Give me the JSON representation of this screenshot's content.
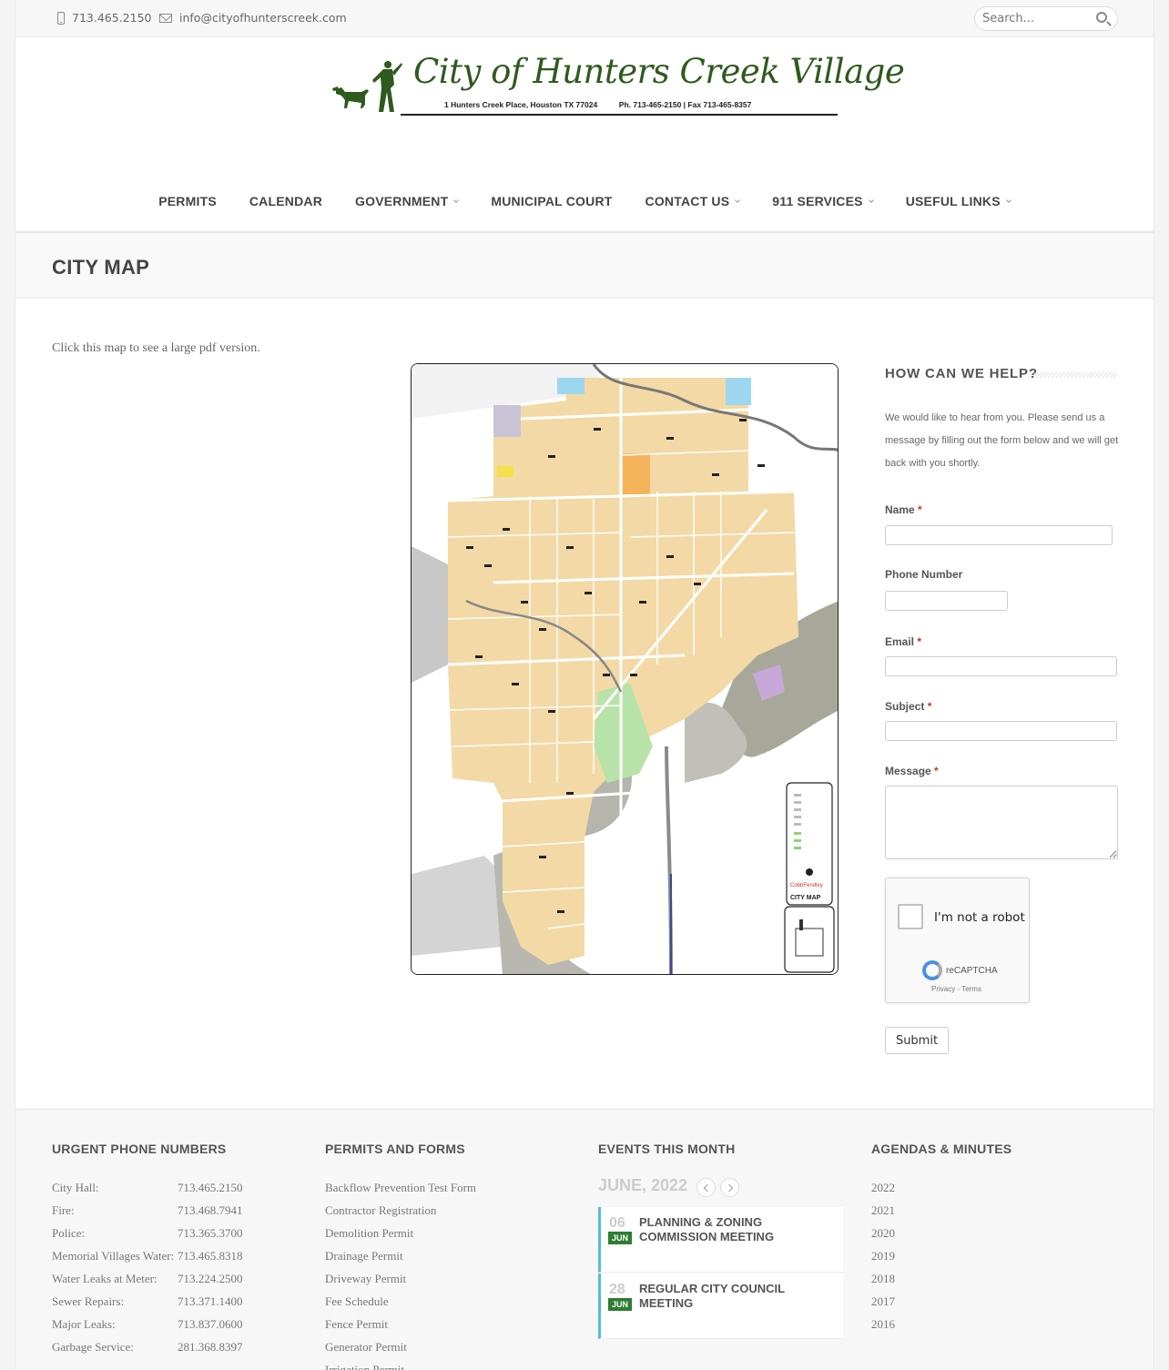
{
  "topbar": {
    "phone": "713.465.2150",
    "email": "info@cityofhunterscreek.com",
    "search_placeholder": "Search..."
  },
  "logo": {
    "title": "City of Hunters Creek Village",
    "subtitle": "1 Hunters Creek Place, Houston TX 77024          Ph. 713-465-2150 | Fax 713-465-8357"
  },
  "nav": [
    {
      "label": "PERMITS",
      "dropdown": false
    },
    {
      "label": "CALENDAR",
      "dropdown": false
    },
    {
      "label": "GOVERNMENT",
      "dropdown": true
    },
    {
      "label": "MUNICIPAL COURT",
      "dropdown": false
    },
    {
      "label": "CONTACT US",
      "dropdown": true
    },
    {
      "label": "911 SERVICES",
      "dropdown": true
    },
    {
      "label": "USEFUL LINKS",
      "dropdown": true
    }
  ],
  "page": {
    "title": "CITY MAP",
    "intro": "Click this map to see a large pdf version."
  },
  "map": {
    "legend_title": "CITY MAP",
    "legend_brand": "CobbFendley"
  },
  "sidebar": {
    "title": "HOW CAN WE HELP?",
    "text": "We would like to hear from you. Please send us a message by filling out the form below and we will get back with you shortly.",
    "fields": {
      "name": "Name",
      "phone": "Phone Number",
      "email": "Email",
      "subject": "Subject",
      "message": "Message"
    },
    "required_mark": "*",
    "captcha": {
      "label": "I'm not a robot",
      "brand": "reCAPTCHA",
      "links": "Privacy - Terms"
    },
    "submit": "Submit"
  },
  "footer": {
    "phones_title": "URGENT PHONE NUMBERS",
    "phones": [
      {
        "label": "City Hall:",
        "value": "713.465.2150"
      },
      {
        "label": "Fire:",
        "value": "713.468.7941"
      },
      {
        "label": "Police:",
        "value": "713.365.3700"
      },
      {
        "label": "Memorial Villages Water:",
        "value": "713.465.8318"
      },
      {
        "label": "Water Leaks at Meter:",
        "value": "713.224.2500"
      },
      {
        "label": "Sewer Repairs:",
        "value": "713.371.1400"
      },
      {
        "label": "Major Leaks:",
        "value": "713.837.0600"
      },
      {
        "label": "Garbage Service:",
        "value": "281.368.8397"
      }
    ],
    "permits_title": "PERMITS AND FORMS",
    "permits": [
      "Backflow Prevention Test Form",
      "Contractor Registration",
      "Demolition Permit",
      "Drainage Permit",
      "Driveway Permit",
      "Fee Schedule",
      "Fence Permit",
      "Generator Permit",
      "Irrigation Permit"
    ],
    "events_title": "EVENTS THIS MONTH",
    "month": "JUNE, 2022",
    "events": [
      {
        "day": "06",
        "month": "JUN",
        "title": "PLANNING & ZONING COMMISSION MEETING"
      },
      {
        "day": "28",
        "month": "JUN",
        "title": "REGULAR CITY COUNCIL MEETING"
      }
    ],
    "agendas_title": "AGENDAS & MINUTES",
    "agendas": [
      "2022",
      "2021",
      "2020",
      "2019",
      "2018",
      "2017",
      "2016"
    ]
  }
}
